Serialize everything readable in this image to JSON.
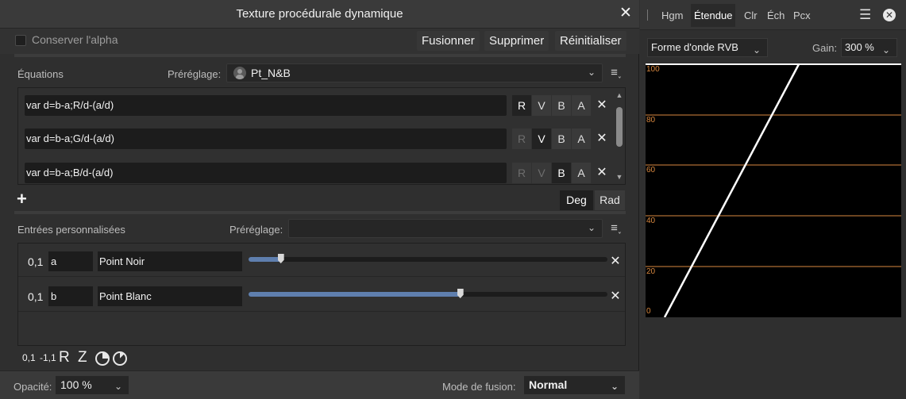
{
  "dialog": {
    "title": "Texture procédurale dynamique",
    "close_glyph": "✕",
    "preserve_alpha_label": "Conserver l'alpha",
    "buttons": {
      "merge": "Fusionner",
      "delete": "Supprimer",
      "reset": "Réinitialiser"
    }
  },
  "equations": {
    "section_label": "Équations",
    "preset_label": "Préréglage:",
    "preset_value": "Pt_N&B",
    "rows": [
      {
        "text": "var d=b-a;R/d-(a/d)",
        "R": "R",
        "V": "V",
        "B": "B",
        "A": "A",
        "active": "R"
      },
      {
        "text": "var d=b-a;G/d-(a/d)",
        "R": "R",
        "V": "V",
        "B": "B",
        "A": "A",
        "active": "V"
      },
      {
        "text": "var d=b-a;B/d-(a/d)",
        "R": "R",
        "V": "V",
        "B": "B",
        "A": "A",
        "active": "B"
      }
    ],
    "add_glyph": "+",
    "angle_modes": {
      "deg": "Deg",
      "rad": "Rad",
      "selected": "Deg"
    }
  },
  "inputs": {
    "section_label": "Entrées personnalisées",
    "preset_label": "Préréglage:",
    "preset_value": "",
    "rows": [
      {
        "type_label": "0,1",
        "var": "a",
        "name": "Point Noir",
        "value_fraction": 0.09
      },
      {
        "type_label": "0,1",
        "var": "b",
        "name": "Point Blanc",
        "value_fraction": 0.59
      }
    ],
    "toolbar": {
      "unit": "0,1",
      "signed": "-1,1",
      "r": "R",
      "z": "Z"
    }
  },
  "footer": {
    "opacity_label": "Opacité:",
    "opacity_value": "100 %",
    "blend_label": "Mode de fusion:",
    "blend_value": "Normal"
  },
  "panel": {
    "tabs": [
      "Hgm",
      "Étendue",
      "Clr",
      "Éch",
      "Pcx"
    ],
    "active_tab": "Étendue",
    "mode_value": "Forme d'onde RVB",
    "gain_label": "Gain:",
    "gain_value": "300 %",
    "scope_labels": [
      "100",
      "80",
      "60",
      "40",
      "20",
      "0"
    ],
    "guide_color": "#d9883f"
  },
  "colors": {
    "accent": "#5f7fae",
    "background": "#2f2f2f",
    "field": "#1c1c1c"
  }
}
